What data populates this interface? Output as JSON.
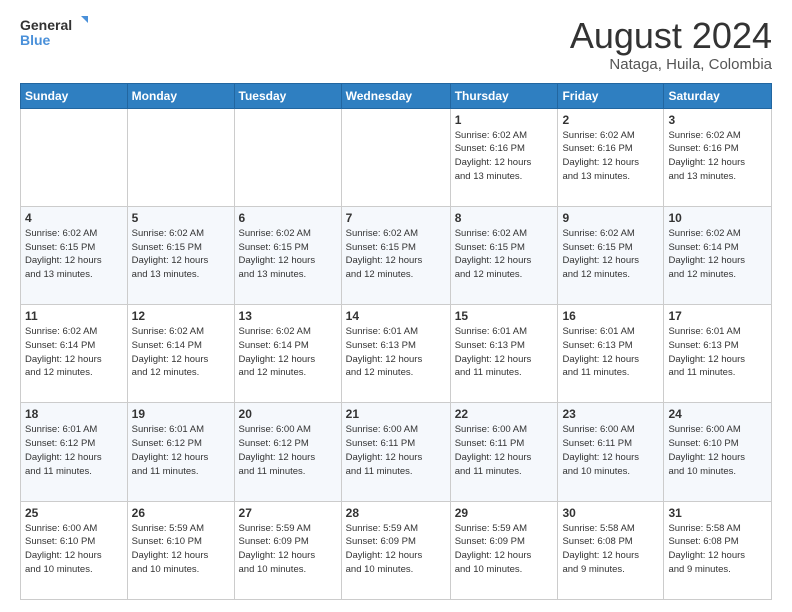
{
  "header": {
    "logo_general": "General",
    "logo_blue": "Blue",
    "month_title": "August 2024",
    "location": "Nataga, Huila, Colombia"
  },
  "weekdays": [
    "Sunday",
    "Monday",
    "Tuesday",
    "Wednesday",
    "Thursday",
    "Friday",
    "Saturday"
  ],
  "weeks": [
    [
      {
        "day": "",
        "info": ""
      },
      {
        "day": "",
        "info": ""
      },
      {
        "day": "",
        "info": ""
      },
      {
        "day": "",
        "info": ""
      },
      {
        "day": "1",
        "info": "Sunrise: 6:02 AM\nSunset: 6:16 PM\nDaylight: 12 hours\nand 13 minutes."
      },
      {
        "day": "2",
        "info": "Sunrise: 6:02 AM\nSunset: 6:16 PM\nDaylight: 12 hours\nand 13 minutes."
      },
      {
        "day": "3",
        "info": "Sunrise: 6:02 AM\nSunset: 6:16 PM\nDaylight: 12 hours\nand 13 minutes."
      }
    ],
    [
      {
        "day": "4",
        "info": "Sunrise: 6:02 AM\nSunset: 6:15 PM\nDaylight: 12 hours\nand 13 minutes."
      },
      {
        "day": "5",
        "info": "Sunrise: 6:02 AM\nSunset: 6:15 PM\nDaylight: 12 hours\nand 13 minutes."
      },
      {
        "day": "6",
        "info": "Sunrise: 6:02 AM\nSunset: 6:15 PM\nDaylight: 12 hours\nand 13 minutes."
      },
      {
        "day": "7",
        "info": "Sunrise: 6:02 AM\nSunset: 6:15 PM\nDaylight: 12 hours\nand 12 minutes."
      },
      {
        "day": "8",
        "info": "Sunrise: 6:02 AM\nSunset: 6:15 PM\nDaylight: 12 hours\nand 12 minutes."
      },
      {
        "day": "9",
        "info": "Sunrise: 6:02 AM\nSunset: 6:15 PM\nDaylight: 12 hours\nand 12 minutes."
      },
      {
        "day": "10",
        "info": "Sunrise: 6:02 AM\nSunset: 6:14 PM\nDaylight: 12 hours\nand 12 minutes."
      }
    ],
    [
      {
        "day": "11",
        "info": "Sunrise: 6:02 AM\nSunset: 6:14 PM\nDaylight: 12 hours\nand 12 minutes."
      },
      {
        "day": "12",
        "info": "Sunrise: 6:02 AM\nSunset: 6:14 PM\nDaylight: 12 hours\nand 12 minutes."
      },
      {
        "day": "13",
        "info": "Sunrise: 6:02 AM\nSunset: 6:14 PM\nDaylight: 12 hours\nand 12 minutes."
      },
      {
        "day": "14",
        "info": "Sunrise: 6:01 AM\nSunset: 6:13 PM\nDaylight: 12 hours\nand 12 minutes."
      },
      {
        "day": "15",
        "info": "Sunrise: 6:01 AM\nSunset: 6:13 PM\nDaylight: 12 hours\nand 11 minutes."
      },
      {
        "day": "16",
        "info": "Sunrise: 6:01 AM\nSunset: 6:13 PM\nDaylight: 12 hours\nand 11 minutes."
      },
      {
        "day": "17",
        "info": "Sunrise: 6:01 AM\nSunset: 6:13 PM\nDaylight: 12 hours\nand 11 minutes."
      }
    ],
    [
      {
        "day": "18",
        "info": "Sunrise: 6:01 AM\nSunset: 6:12 PM\nDaylight: 12 hours\nand 11 minutes."
      },
      {
        "day": "19",
        "info": "Sunrise: 6:01 AM\nSunset: 6:12 PM\nDaylight: 12 hours\nand 11 minutes."
      },
      {
        "day": "20",
        "info": "Sunrise: 6:00 AM\nSunset: 6:12 PM\nDaylight: 12 hours\nand 11 minutes."
      },
      {
        "day": "21",
        "info": "Sunrise: 6:00 AM\nSunset: 6:11 PM\nDaylight: 12 hours\nand 11 minutes."
      },
      {
        "day": "22",
        "info": "Sunrise: 6:00 AM\nSunset: 6:11 PM\nDaylight: 12 hours\nand 11 minutes."
      },
      {
        "day": "23",
        "info": "Sunrise: 6:00 AM\nSunset: 6:11 PM\nDaylight: 12 hours\nand 10 minutes."
      },
      {
        "day": "24",
        "info": "Sunrise: 6:00 AM\nSunset: 6:10 PM\nDaylight: 12 hours\nand 10 minutes."
      }
    ],
    [
      {
        "day": "25",
        "info": "Sunrise: 6:00 AM\nSunset: 6:10 PM\nDaylight: 12 hours\nand 10 minutes."
      },
      {
        "day": "26",
        "info": "Sunrise: 5:59 AM\nSunset: 6:10 PM\nDaylight: 12 hours\nand 10 minutes."
      },
      {
        "day": "27",
        "info": "Sunrise: 5:59 AM\nSunset: 6:09 PM\nDaylight: 12 hours\nand 10 minutes."
      },
      {
        "day": "28",
        "info": "Sunrise: 5:59 AM\nSunset: 6:09 PM\nDaylight: 12 hours\nand 10 minutes."
      },
      {
        "day": "29",
        "info": "Sunrise: 5:59 AM\nSunset: 6:09 PM\nDaylight: 12 hours\nand 10 minutes."
      },
      {
        "day": "30",
        "info": "Sunrise: 5:58 AM\nSunset: 6:08 PM\nDaylight: 12 hours\nand 9 minutes."
      },
      {
        "day": "31",
        "info": "Sunrise: 5:58 AM\nSunset: 6:08 PM\nDaylight: 12 hours\nand 9 minutes."
      }
    ]
  ]
}
